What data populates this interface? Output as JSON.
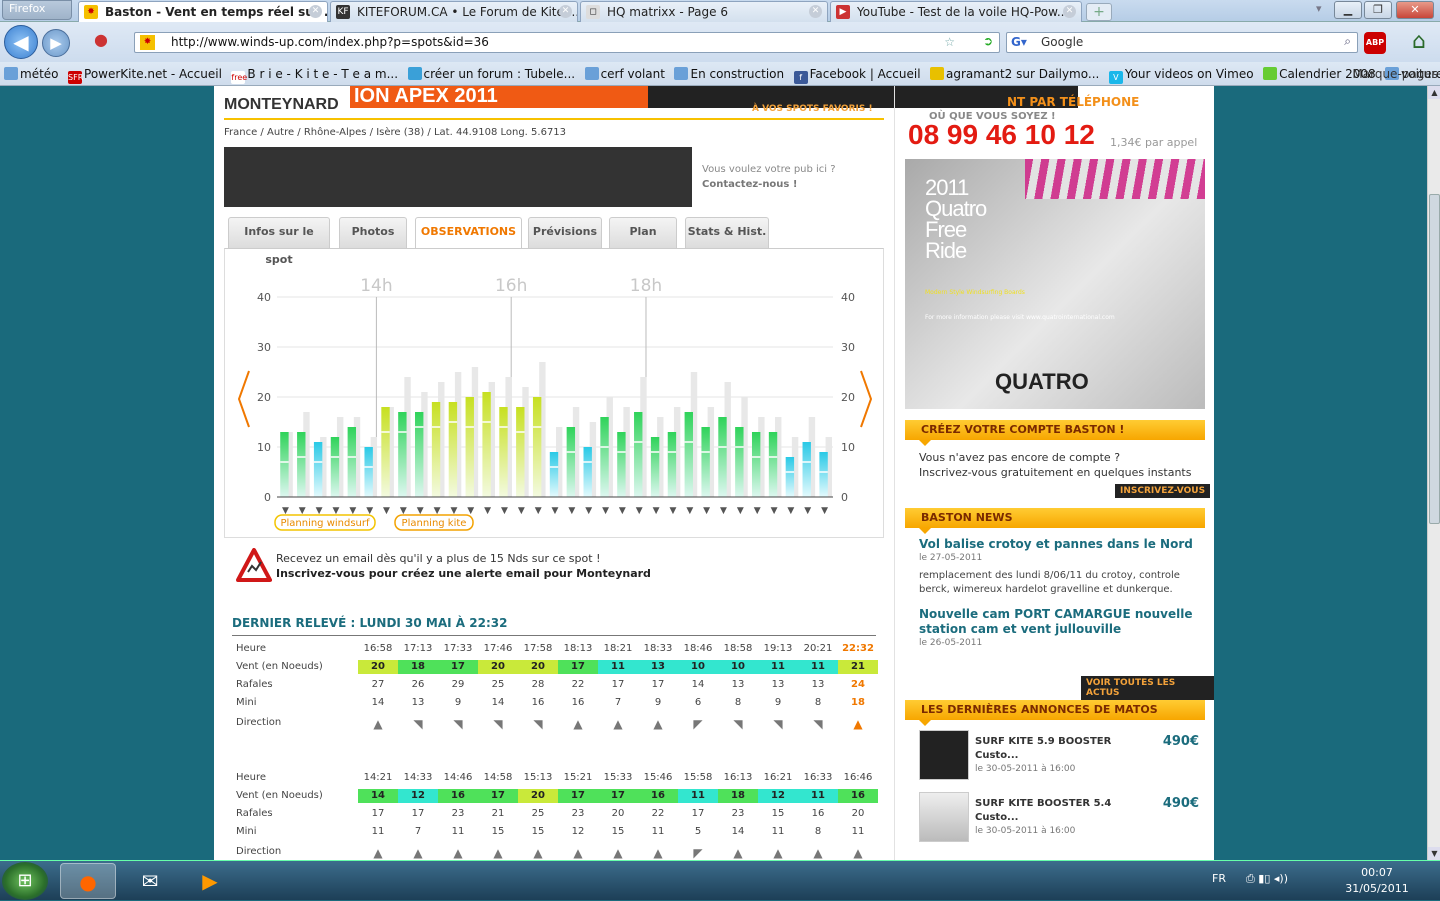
{
  "browser": {
    "menu_label": "Firefox",
    "tabs": [
      {
        "label": "Baston - Vent en temps réel sur ...",
        "active": true
      },
      {
        "label": "KITEFORUM.CA • Le Forum de Kite ...",
        "active": false
      },
      {
        "label": "HQ matrixx - Page 6",
        "active": false
      },
      {
        "label": "YouTube - Test de la voile HQ-Pow...",
        "active": false
      }
    ],
    "url": "http://www.winds-up.com/index.php?p=spots&id=36",
    "search_engine": "Google",
    "bookmarks": [
      "météo",
      "PowerKite.net - Accueil",
      "B r i e - K i t e - T e a m...",
      "créer un forum : Tubele...",
      "cerf volant",
      "En construction",
      "Facebook | Accueil",
      "agramant2 sur Dailymo...",
      "Your videos on Vimeo",
      "Calendrier 2008",
      "voiture"
    ],
    "bookmarks_menu": "Marque-pages"
  },
  "page": {
    "spot_name": "MONTEYNARD",
    "banner_text": "ION APEX 2011",
    "fav_link": "À VOS SPOTS FAVORIS !",
    "breadcrumb": "France / Autre / Rhône-Alpes / Isère (38) / Lat. 44.9108 Long. 5.6713",
    "ad_line1": "Vous voulez votre pub ici ?",
    "ad_line2": "Contactez-nous !",
    "tabs": [
      "Infos sur le spot",
      "Photos",
      "OBSERVATIONS",
      "Prévisions",
      "Plan",
      "Stats & Hist."
    ],
    "alert_line1": "Recevez un email dès qu'il y a plus de 15 Nds sur ce spot !",
    "alert_line2": "Inscrivez-vous pour créez une alerte email pour Monteynard",
    "last_reading": "DERNIER RELEVÉ : LUNDI 30 MAI À 22:32"
  },
  "chart_data": {
    "type": "bar",
    "x_hour_labels": [
      "14h",
      "16h",
      "18h"
    ],
    "yticks": [
      0,
      10,
      20,
      30,
      40
    ],
    "ylim": [
      0,
      40
    ],
    "legend": [
      "Planning windsurf",
      "Planning kite"
    ],
    "wind": [
      13,
      13,
      11,
      12,
      14,
      10,
      18,
      17,
      17,
      19,
      19,
      20,
      21,
      18,
      18,
      20,
      9,
      14,
      10,
      16,
      13,
      17,
      12,
      13,
      17,
      14,
      16,
      14,
      13,
      13,
      8,
      11,
      9
    ],
    "gusts": [
      13,
      17,
      12,
      16,
      16,
      12,
      18,
      24,
      21,
      23,
      25,
      26,
      23,
      24,
      22,
      27,
      14,
      18,
      15,
      20,
      18,
      24,
      16,
      18,
      25,
      18,
      23,
      20,
      16,
      16,
      12,
      16,
      12
    ],
    "mini": [
      7,
      8,
      7,
      8,
      8,
      6,
      13,
      13,
      14,
      14,
      15,
      14,
      15,
      14,
      13,
      14,
      6,
      9,
      7,
      10,
      9,
      11,
      9,
      9,
      11,
      9,
      10,
      10,
      8,
      8,
      5,
      7,
      5
    ]
  },
  "observations": [
    {
      "labels": {
        "time": "Heure",
        "wind": "Vent (en Noeuds)",
        "gust": "Rafales",
        "mini": "Mini",
        "dir": "Direction"
      },
      "times": [
        "16:58",
        "17:13",
        "17:33",
        "17:46",
        "17:58",
        "18:13",
        "18:21",
        "18:33",
        "18:46",
        "18:58",
        "19:13",
        "20:21",
        "22:32"
      ],
      "wind": [
        "20",
        "18",
        "17",
        "20",
        "20",
        "17",
        "11",
        "13",
        "10",
        "10",
        "11",
        "11",
        "21"
      ],
      "gust": [
        "27",
        "26",
        "29",
        "25",
        "28",
        "22",
        "17",
        "17",
        "14",
        "13",
        "13",
        "13",
        "24"
      ],
      "mini": [
        "14",
        "13",
        "9",
        "14",
        "16",
        "16",
        "7",
        "9",
        "6",
        "8",
        "9",
        "8",
        "18"
      ],
      "dir": [
        "▲",
        "◥",
        "◥",
        "◥",
        "◥",
        "▲",
        "▲",
        "▲",
        "◤",
        "◥",
        "◥",
        "◥",
        "▲"
      ]
    },
    {
      "labels": {
        "time": "Heure",
        "wind": "Vent (en Noeuds)",
        "gust": "Rafales",
        "mini": "Mini",
        "dir": "Direction"
      },
      "times": [
        "14:21",
        "14:33",
        "14:46",
        "14:58",
        "15:13",
        "15:21",
        "15:33",
        "15:46",
        "15:58",
        "16:13",
        "16:21",
        "16:33",
        "16:46"
      ],
      "wind": [
        "14",
        "12",
        "16",
        "17",
        "20",
        "17",
        "17",
        "16",
        "11",
        "18",
        "12",
        "11",
        "16"
      ],
      "gust": [
        "17",
        "17",
        "23",
        "21",
        "25",
        "23",
        "20",
        "22",
        "17",
        "23",
        "15",
        "16",
        "20"
      ],
      "mini": [
        "11",
        "7",
        "11",
        "15",
        "15",
        "12",
        "15",
        "11",
        "5",
        "14",
        "11",
        "8",
        "11"
      ],
      "dir": [
        "▲",
        "▲",
        "▲",
        "▲",
        "▲",
        "▲",
        "▲",
        "▲",
        "◤",
        "▲",
        "▲",
        "▲",
        "▲"
      ]
    }
  ],
  "sidebar": {
    "phone_header": "NT PAR TÉLÉPHONE",
    "phone_sub": "OÙ QUE VOUS SOYEZ !",
    "phone_number": "08 99 46 10 12",
    "phone_price": "1,34€ par appel",
    "ad_year": "2011",
    "ad_lines": [
      "Quatro",
      "Free",
      "Ride"
    ],
    "ad_tag": "Modern Style Windsurfing Boards",
    "ad_info": "For more information please visit www.quatrointernational.com",
    "ad_brand": "QUATRO",
    "account_header": "CRÉEZ VOTRE COMPTE BASTON !",
    "account_l1": "Vous n'avez pas encore de compte ?",
    "account_l2": "Inscrivez-vous gratuitement en quelques instants",
    "account_btn": "INSCRIVEZ-VOUS",
    "news_header": "BASTON NEWS",
    "news": [
      {
        "title": "Vol balise crotoy et pannes dans le Nord",
        "date": "le 27-05-2011",
        "body": "remplacement des lundi 8/06/11 du crotoy, controle berck, wimereux hardelot gravelline et dunkerque."
      },
      {
        "title": "Nouvelle cam PORT CAMARGUE nouvelle station cam et vent jullouville",
        "date": "le 26-05-2011",
        "body": ""
      }
    ],
    "news_btn": "VOIR TOUTES LES ACTUS",
    "ads_header": "LES DERNIÈRES ANNONCES DE MATOS",
    "ads": [
      {
        "title": "SURF KITE 5.9 BOOSTER",
        "sub": "Custo...",
        "date": "le 30-05-2011 à 16:00",
        "price": "490€"
      },
      {
        "title": "SURF KITE BOOSTER 5.4",
        "sub": "Custo...",
        "date": "le 30-05-2011 à 16:00",
        "price": "490€"
      }
    ]
  },
  "taskbar": {
    "lang": "FR",
    "time": "00:07",
    "date": "31/05/2011"
  }
}
